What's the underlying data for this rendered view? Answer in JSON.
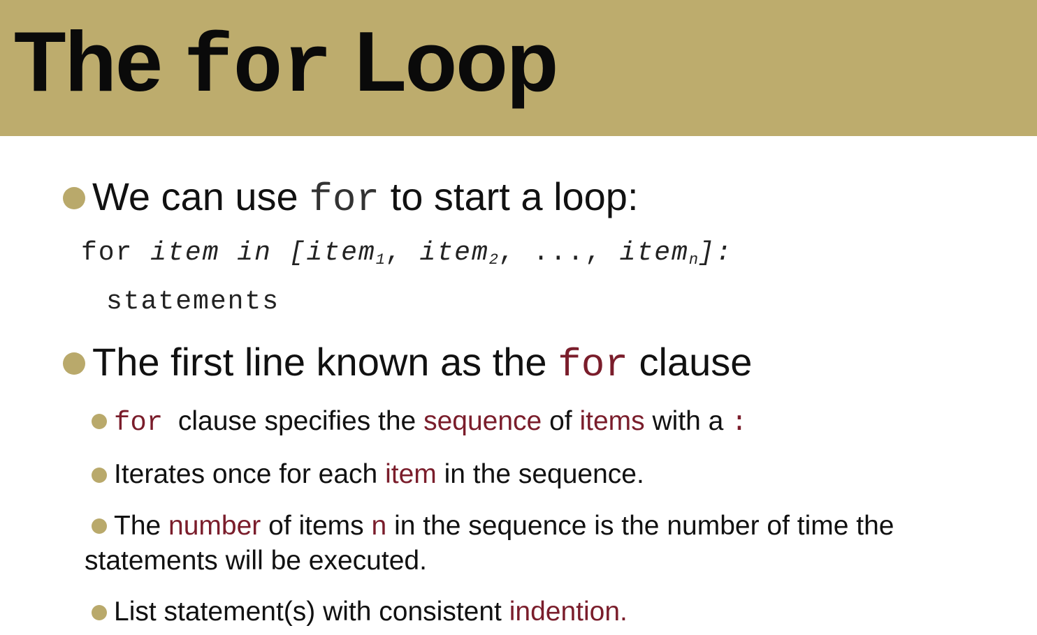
{
  "slide": {
    "title": {
      "pre": "The",
      "code": "for",
      "post": "Loop"
    },
    "bullets": [
      {
        "pre": "We can use",
        "code": "for",
        "post": "to start a loop:"
      },
      {
        "pre": "The first line known as the",
        "code": "for",
        "post": "clause"
      }
    ],
    "code_block": {
      "line1": {
        "kw_for": "for",
        "item": "item",
        "kw_in": "in",
        "open": "[",
        "item1": "item",
        "sub1": "1",
        "sep1": ",",
        "item2": "item",
        "sub2": "2",
        "sep2": ",",
        "ellipsis": "...,",
        "itemn": "item",
        "subn": "n",
        "close": "]:"
      },
      "line2": "statements"
    },
    "sub_bullets": [
      {
        "code": "for",
        "t1": "clause specifies the",
        "h1": "sequence",
        "t2": "of",
        "h2": "items",
        "t3": "with a",
        "colon": ":"
      },
      {
        "t1": "Iterates once for each",
        "h1": "item",
        "t2": "in the sequence."
      },
      {
        "t1": "The",
        "h1": "number",
        "t2": "of items",
        "h2": "n",
        "t3": "in the sequence is the number of time the",
        "t4": "statements will be executed."
      },
      {
        "t1": "List statement(s) with consistent",
        "h1": "indention."
      }
    ],
    "colors": {
      "title_bar": "#bdac6d",
      "bullet": "#b9a96b",
      "highlight": "#7a1d2b"
    }
  }
}
